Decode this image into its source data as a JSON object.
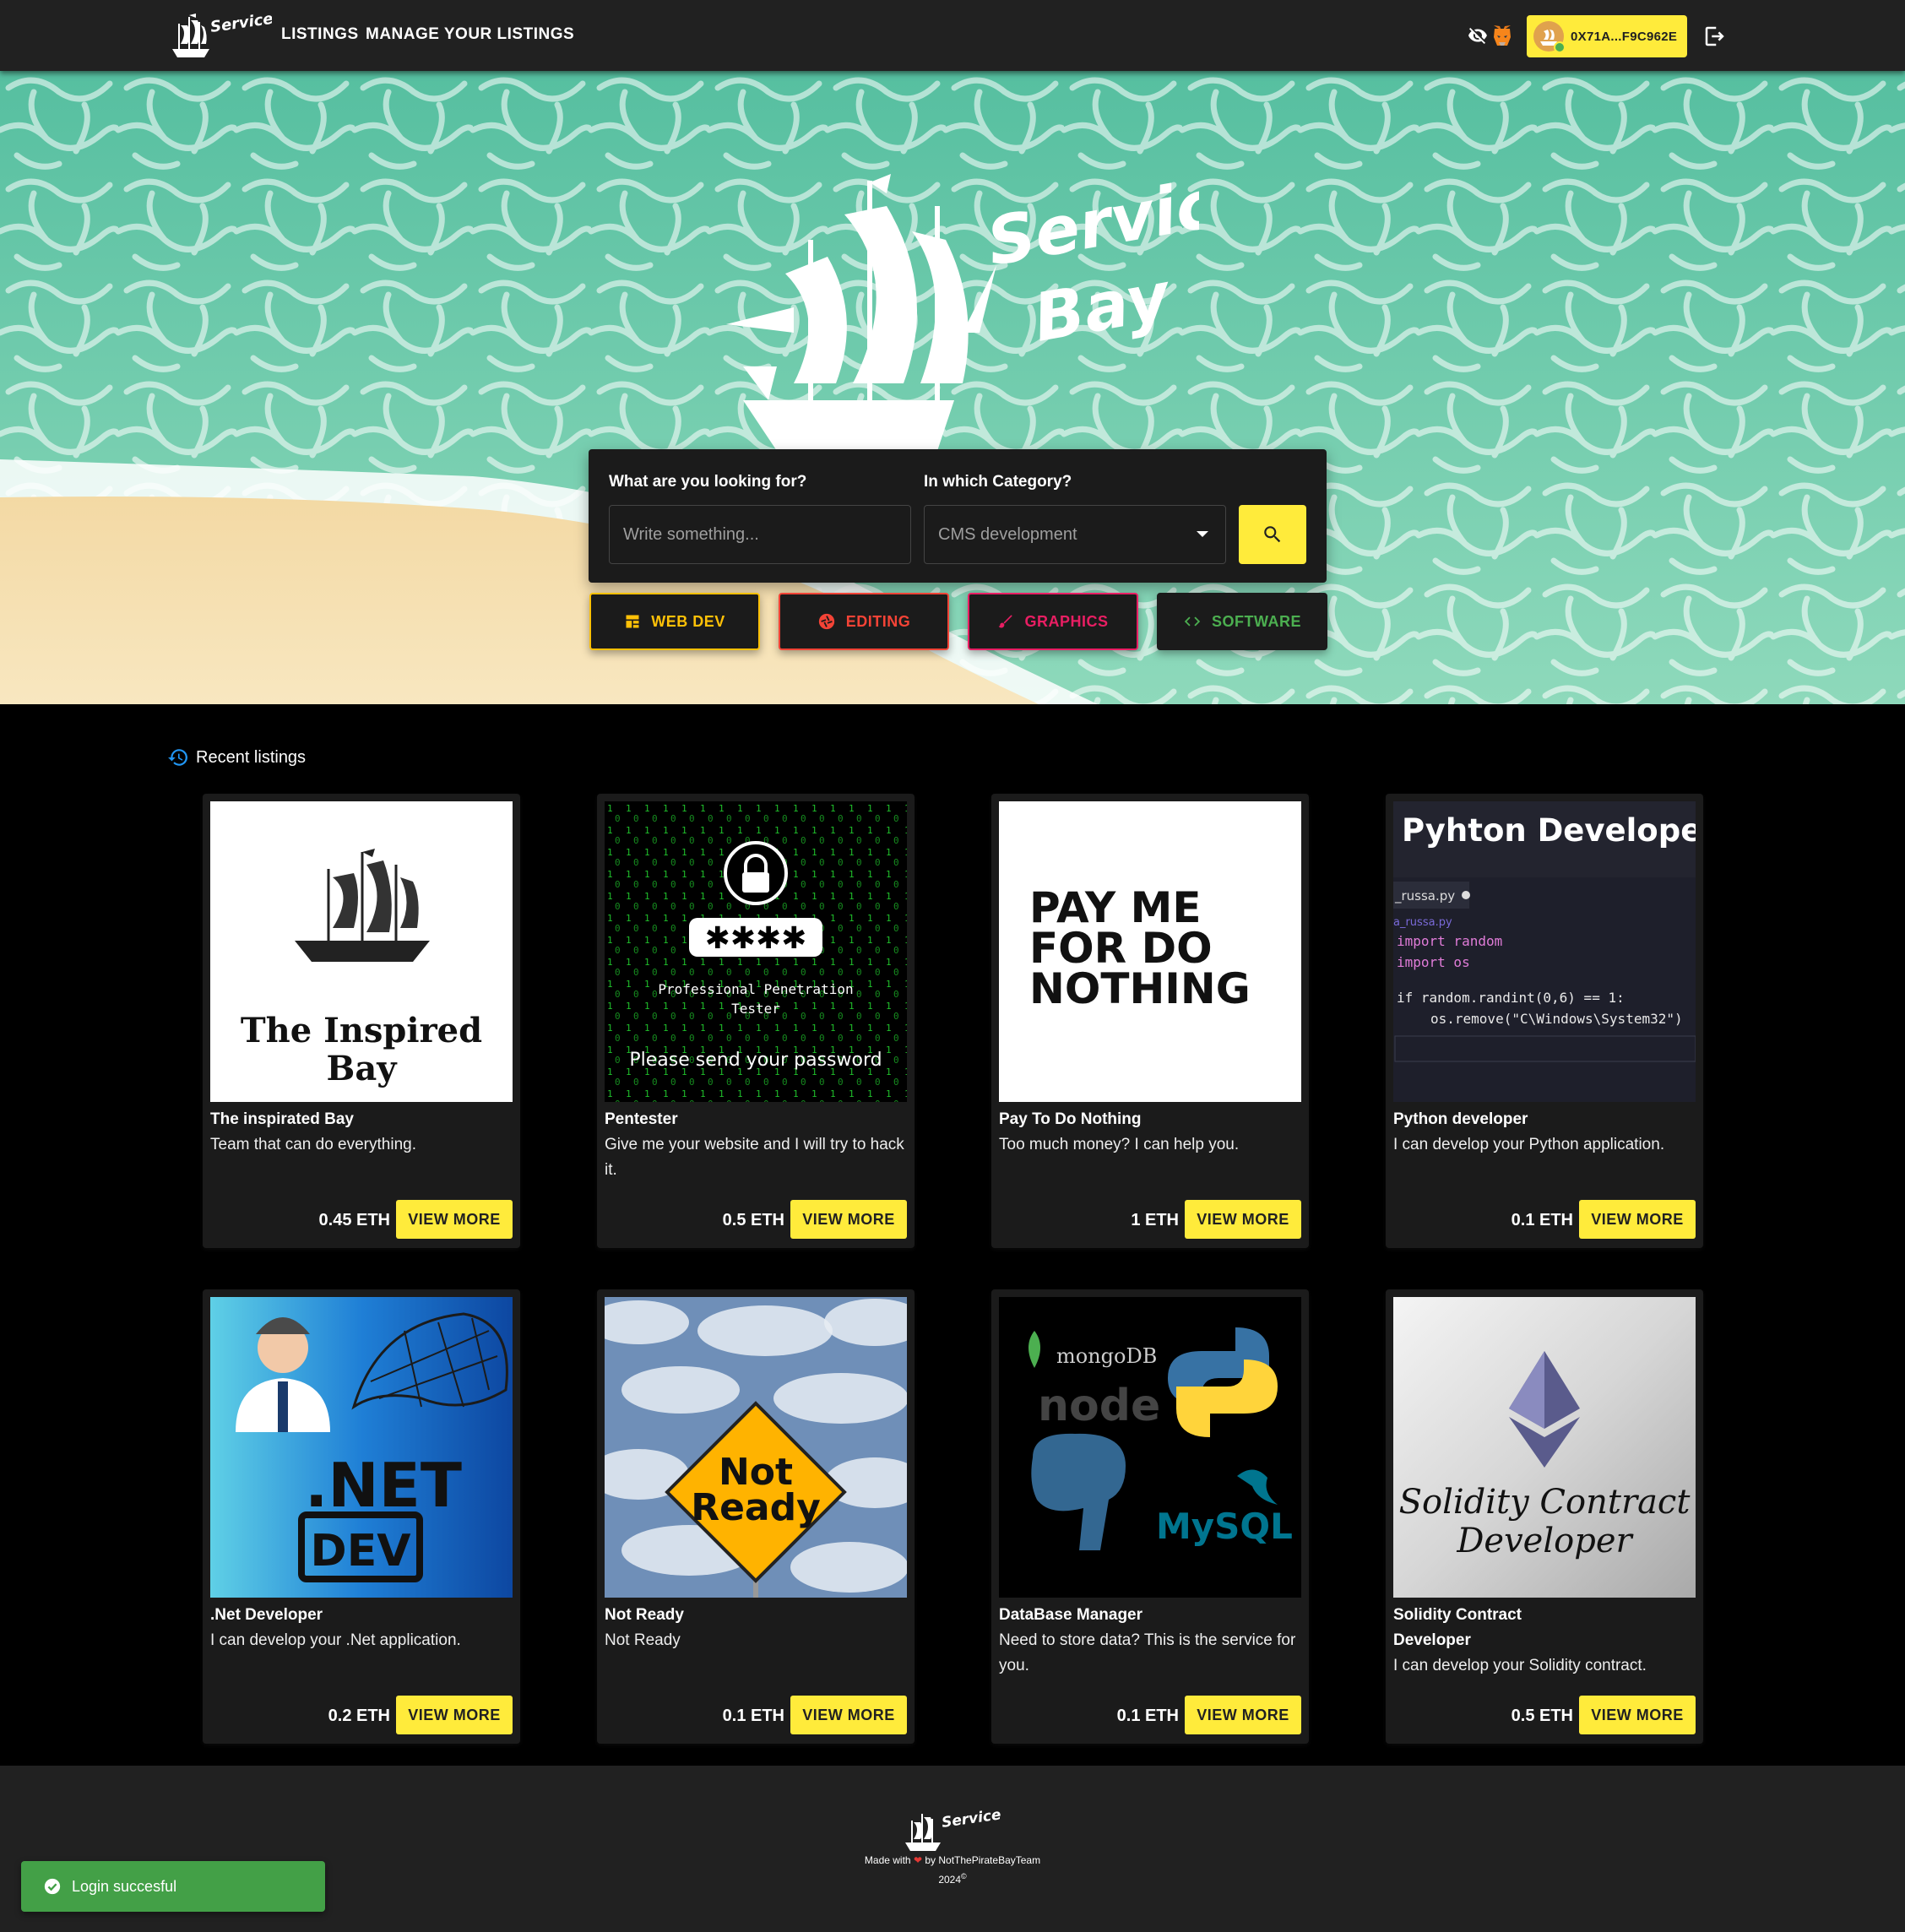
{
  "nav": {
    "brand": "Service Bay",
    "links": [
      "LISTINGS",
      "MANAGE YOUR LISTINGS"
    ],
    "wallet_address": "0X71A...F9C962E",
    "icons": [
      "visibility-off-icon",
      "metamask-fox-icon",
      "logout-icon"
    ]
  },
  "hero": {
    "logo_text": [
      "Service",
      "Bay"
    ],
    "search": {
      "query_label": "What are you looking for?",
      "query_placeholder": "Write something...",
      "category_label": "In which Category?",
      "category_value": "CMS development"
    },
    "categories": [
      {
        "label": "WEB DEV",
        "color": "#ffc107",
        "icon": "dashboard-icon"
      },
      {
        "label": "EDITING",
        "color": "#f44336",
        "icon": "shutter-icon"
      },
      {
        "label": "GRAPHICS",
        "color": "#e91e63",
        "icon": "brush-icon"
      },
      {
        "label": "SOFTWARE",
        "color": "#4caf50",
        "icon": "code-icon"
      }
    ]
  },
  "recent": {
    "title": "Recent listings",
    "view_more_label": "VIEW MORE",
    "listings": [
      {
        "title": "The inspirated Bay",
        "description": "Team that can do everything.",
        "price": "0.45 ETH",
        "image_text": [
          "The Inspired",
          "Bay"
        ]
      },
      {
        "title": "Pentester",
        "description": "Give me your website and I will try to hack it.",
        "price": "0.5 ETH",
        "image_text": [
          "✱✱✱✱",
          "Professional Penetration",
          "Tester",
          "Please send your password"
        ]
      },
      {
        "title": "Pay To Do Nothing",
        "description": "Too much money? I can help you.",
        "price": "1 ETH",
        "image_text": [
          "PAY ME",
          "FOR DO",
          "NOTHING"
        ]
      },
      {
        "title": "Python developer",
        "description": "I can develop your Python application.",
        "price": "0.1 ETH",
        "image_text": [
          "Pyhton Developer",
          "_russa.py",
          "a_russa.py",
          "import random",
          "import os",
          "if random.randint(0,6) == 1:",
          "os.remove(\"C\\Windows\\System32\")"
        ]
      },
      {
        "title": ".Net Developer",
        "description": "I can develop your .Net application.",
        "price": "0.2 ETH",
        "image_text": [
          ".NET",
          "DEV"
        ]
      },
      {
        "title": "Not Ready",
        "description": "Not Ready",
        "price": "0.1 ETH",
        "image_text": [
          "Not",
          "Ready"
        ]
      },
      {
        "title": "DataBase Manager",
        "description": "Need to store data? This is the service for you.",
        "price": "0.1 ETH",
        "image_text": [
          "mongoDB",
          "node",
          "MySQL"
        ]
      },
      {
        "title": "Solidity Contract Developer",
        "description": "I can develop your Solidity contract.",
        "price": "0.5 ETH",
        "image_text": [
          "Solidity Contract",
          "Developer"
        ]
      }
    ]
  },
  "footer": {
    "made_with_prefix": "Made with",
    "made_with_suffix": "by NotThePirateBayTeam",
    "year": "2024",
    "copyright_symbol": "©"
  },
  "toast": {
    "message": "Login succesful"
  },
  "colors": {
    "accent": "#ffeb3b",
    "sea": "#5ec6a4",
    "sand": "#f5e2b0",
    "card": "#1b1b1b",
    "toast": "#43a047"
  }
}
